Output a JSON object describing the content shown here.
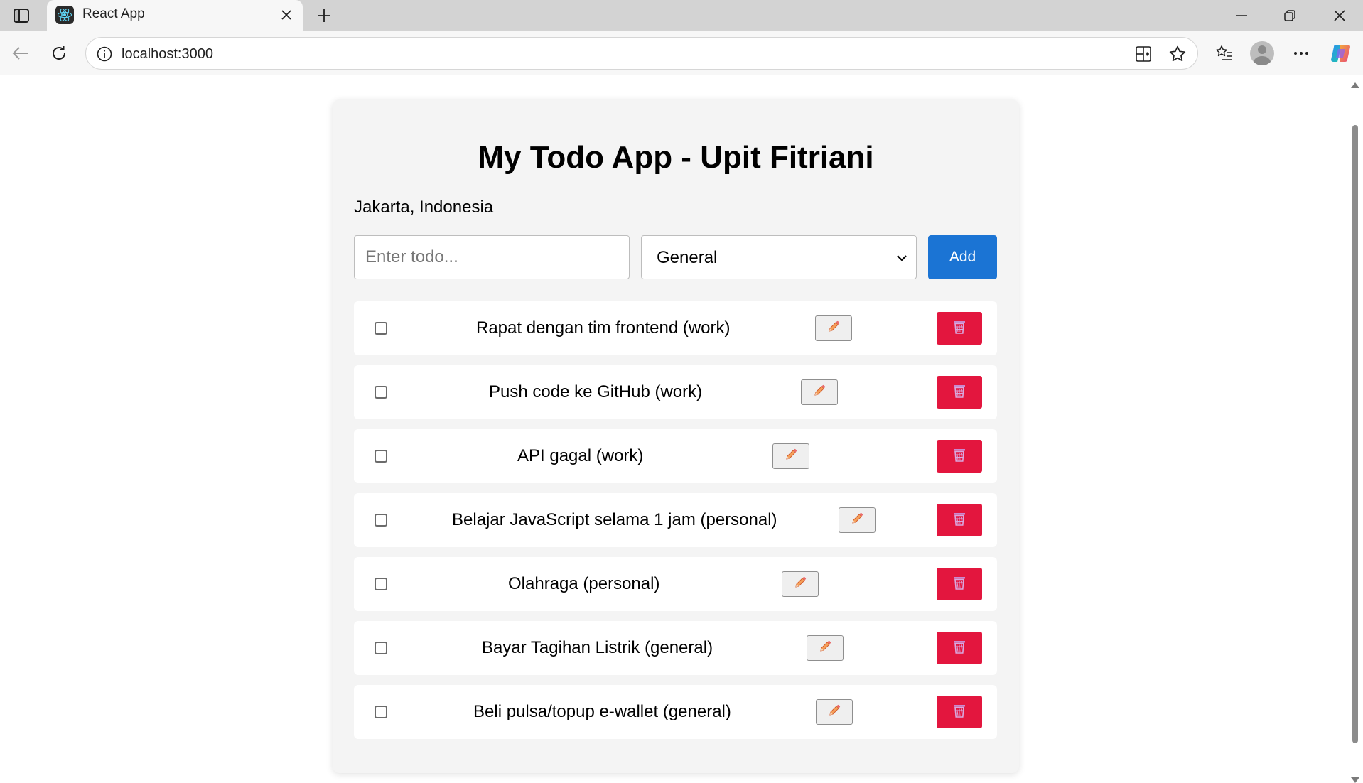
{
  "browser": {
    "tab_title": "React App",
    "url": "localhost:3000",
    "icons": {
      "sidebar": "sidebar-toggle-icon",
      "favicon": "react-logo-icon",
      "close": "close-icon",
      "new_tab": "plus-icon",
      "back": "back-arrow-icon",
      "refresh": "refresh-icon",
      "site_info": "info-icon",
      "split_screen": "split-screen-icon",
      "favorite": "star-icon",
      "favorites": "favorites-list-icon",
      "profile": "avatar-icon",
      "more": "more-icon",
      "copilot": "copilot-icon"
    }
  },
  "app": {
    "title": "My Todo App - Upit Fitriani",
    "location": "Jakarta, Indonesia",
    "input_placeholder": "Enter todo...",
    "category_selected": "General",
    "add_label": "Add",
    "accent_color": "#1b74d4",
    "delete_color": "#e3163e",
    "todos": [
      {
        "text": "Rapat dengan tim frontend (work)",
        "done": false
      },
      {
        "text": "Push code ke GitHub (work)",
        "done": false
      },
      {
        "text": "API gagal (work)",
        "done": false
      },
      {
        "text": "Belajar JavaScript selama 1 jam (personal)",
        "done": false
      },
      {
        "text": "Olahraga (personal)",
        "done": false
      },
      {
        "text": "Bayar Tagihan Listrik (general)",
        "done": false
      },
      {
        "text": "Beli pulsa/topup e-wallet (general)",
        "done": false
      }
    ]
  }
}
